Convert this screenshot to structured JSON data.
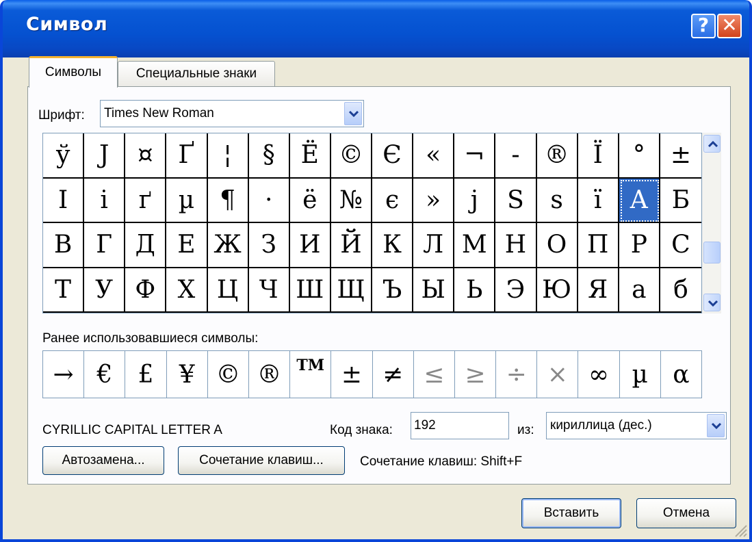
{
  "window": {
    "title": "Символ",
    "help_glyph": "?",
    "close_glyph": "✕"
  },
  "tabs": [
    {
      "label": "Символы",
      "active": true
    },
    {
      "label": "Специальные знаки",
      "active": false
    }
  ],
  "font": {
    "label": "Шрифт:",
    "value": "Times New Roman"
  },
  "symbol_grid": [
    [
      "ў",
      "Ј",
      "¤",
      "Ґ",
      "¦",
      "§",
      "Ё",
      "©",
      "Є",
      "«",
      "¬",
      "-",
      "®",
      "Ї",
      "°",
      "±"
    ],
    [
      "І",
      "і",
      "ґ",
      "µ",
      "¶",
      "·",
      "ё",
      "№",
      "є",
      "»",
      "ј",
      "Ѕ",
      "ѕ",
      "ї",
      "А",
      "Б"
    ],
    [
      "В",
      "Г",
      "Д",
      "Е",
      "Ж",
      "З",
      "И",
      "Й",
      "К",
      "Л",
      "М",
      "Н",
      "О",
      "П",
      "Р",
      "С"
    ],
    [
      "Т",
      "У",
      "Ф",
      "Х",
      "Ц",
      "Ч",
      "Ш",
      "Щ",
      "Ъ",
      "Ы",
      "Ь",
      "Э",
      "Ю",
      "Я",
      "а",
      "б"
    ]
  ],
  "selected": {
    "row": 1,
    "col": 14
  },
  "recent": {
    "label": "Ранее использовавшиеся символы:",
    "symbols": [
      "→",
      "€",
      "£",
      "¥",
      "©",
      "®",
      "TM",
      "±",
      "≠",
      "≤",
      "≥",
      "÷",
      "×",
      "∞",
      "µ",
      "α"
    ]
  },
  "char_name": "CYRILLIC CAPITAL LETTER A",
  "code": {
    "label": "Код знака:",
    "value": "192"
  },
  "from": {
    "label": "из:",
    "value": "кириллица (дес.)"
  },
  "buttons": {
    "autocorrect": "Автозамена...",
    "shortcut_key": "Сочетание клавиш...",
    "insert": "Вставить",
    "cancel": "Отмена"
  },
  "shortcut_info": "Сочетание клавиш: Shift+F",
  "colors": {
    "title_bar": "#0a5bd8",
    "selection": "#316ac5",
    "dialog_bg": "#ece9d8"
  }
}
